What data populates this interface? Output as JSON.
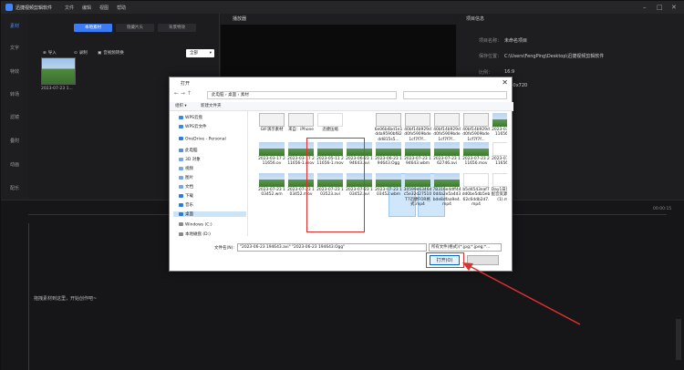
{
  "window": {
    "app_title": "迅捷视频剪辑软件",
    "menus": [
      "文件",
      "编辑",
      "视图",
      "帮助"
    ]
  },
  "leftnav": [
    "素材",
    "文字",
    "特效",
    "转场",
    "滤镜",
    "叠附",
    "动画",
    "配乐"
  ],
  "media": {
    "tabs": [
      "本地素材",
      "隐藏片头",
      "背景特效"
    ],
    "import_label": "导入",
    "record_label": "录制",
    "record_audio_label": "音视频转换",
    "filter_selected": "全部",
    "clip_date": "2023-07-23 1..."
  },
  "player": {
    "title": "播放器"
  },
  "project": {
    "title": "项目信息",
    "fields": [
      {
        "k": "项目名称：",
        "v": "未命名项目"
      },
      {
        "k": "保存位置：",
        "v": "C:\\Users\\FengPing\\Desktop\\迅捷视频剪辑软件"
      },
      {
        "k": "比例：",
        "v": "16:9"
      },
      {
        "k": "",
        "v": "1280x720"
      },
      {
        "k": "",
        "v": "25"
      }
    ]
  },
  "timeline": {
    "hint": "拖拽素材到这里，开始创作吧~",
    "timecode": "00:00:15"
  },
  "dialog": {
    "title": "打开",
    "breadcrumb": "此电脑 › 桌面 › 素材",
    "organize": "组织 ▾",
    "new_folder": "新建文件夹",
    "nav": [
      {
        "label": "WPS云盘",
        "color": "#3b86e6"
      },
      {
        "label": "WPS云文件",
        "color": "#3b86e6"
      },
      {
        "label": "OneDrive - Personal",
        "color": "#2d7fd3"
      },
      {
        "label": "此电脑",
        "color": "#5a8bd6"
      },
      {
        "label": "3D 对象",
        "color": "#7aa6e0"
      },
      {
        "label": "视频",
        "color": "#7aa6e0"
      },
      {
        "label": "图片",
        "color": "#7aa6e0"
      },
      {
        "label": "文档",
        "color": "#7aa6e0"
      },
      {
        "label": "下载",
        "color": "#2b7cd3"
      },
      {
        "label": "音乐",
        "color": "#2b7cd3"
      },
      {
        "label": "桌面",
        "color": "#2b7cd3"
      },
      {
        "label": "Windows (C:)",
        "color": "#888888"
      },
      {
        "label": "本地磁盘 (D:)",
        "color": "#888888"
      },
      {
        "label": "本地磁盘 (E:)",
        "color": "#888888"
      }
    ],
    "files": [
      {
        "label": "GIF演示素材",
        "kind": "doc"
      },
      {
        "label": "来自：iPhone",
        "kind": "doc"
      },
      {
        "label": "迅捷压缩",
        "kind": "app"
      },
      {
        "label": "6e06b4bd1e1dda9590bf82dd815s5...",
        "kind": "doc"
      },
      {
        "label": "40bf14b929dd0fe5909bde1cf7f7f...",
        "kind": "doc"
      },
      {
        "label": "40bf14b929dd0fe5909bde1cf7f7f...",
        "kind": "doc"
      },
      {
        "label": "40bf14b929dd0fe5909bde1cf7f7f...",
        "kind": "doc"
      },
      {
        "label": "2023-03-17 211656.e...",
        "kind": "img"
      },
      {
        "label": "2023-03-17 211656.ov",
        "kind": "img"
      },
      {
        "label": "2023-03-17 211656-1.mov",
        "kind": "img"
      },
      {
        "label": "2023-05-11 211656-1.mov",
        "kind": "img"
      },
      {
        "label": "2023-06-23 194643.avi",
        "kind": "img"
      },
      {
        "label": "2023-06-23 194643.Ogg",
        "kind": "img"
      },
      {
        "label": "2023-07-23 194643.wbm",
        "kind": "img"
      },
      {
        "label": "2023-07-23 162746.avi",
        "kind": "img"
      },
      {
        "label": "2023-07-23 211656.mov",
        "kind": "img"
      },
      {
        "label": "2023-07-23 211656.avi",
        "kind": "app"
      },
      {
        "label": "2023-07-23 103452.wm",
        "kind": "img"
      },
      {
        "label": "2023-07-23 103452.mov",
        "kind": "img"
      },
      {
        "label": "2023-07-23 103523.avi",
        "kind": "img"
      },
      {
        "label": "2023-07-23 103452.avi",
        "kind": "img"
      },
      {
        "label": "2023-07-23 103452.wbm",
        "kind": "img"
      },
      {
        "label": "30599e6346dc5e32d27510T7迅捷FOR格式.mp4",
        "kind": "img"
      },
      {
        "label": "7B316e4dff440d4a2e5a4d3bde8dfaa9e4.mp4",
        "kind": "img"
      },
      {
        "label": "b5d4543eaf7dd0be5db5eb62c6ddb2d7.mp4",
        "kind": "app"
      },
      {
        "label": "Day1日记,迅捷配音资源生音效(1).mp3",
        "kind": "app"
      }
    ],
    "filename_label": "文件名(N):",
    "filename_value": "\"2023-06-23 194643.avi\" \"2023-06-23 194643.Ogg\"",
    "filter_value": "所有文件(格式)(*.jpg;*.jpeg;*...",
    "open_label": "打开(O)",
    "cancel_label": "取消"
  }
}
